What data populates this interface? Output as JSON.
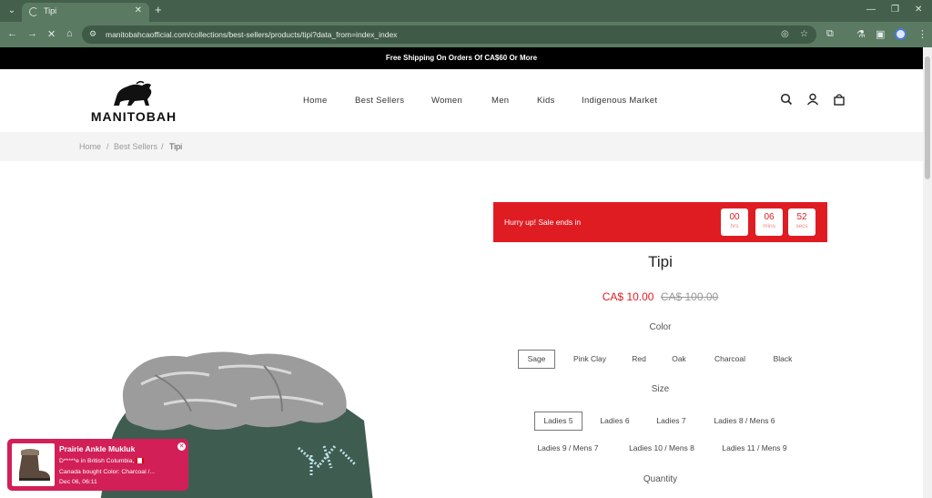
{
  "browser": {
    "tab_title": "Tipi",
    "url": "manitobahcaofficial.com/collections/best-sellers/products/tipi?data_from=index_index"
  },
  "announcement": "Free Shipping On Orders Of CA$60 Or More",
  "header": {
    "logo_text": "MANITOBAH",
    "nav": [
      "Home",
      "Best Sellers",
      "Women",
      "Men",
      "Kids",
      "Indigenous Market"
    ]
  },
  "breadcrumb": [
    "Home",
    "Best Sellers",
    "Tipi"
  ],
  "timer": {
    "label": "Hurry up!  Sale ends in",
    "hours": "00",
    "hours_unit": "hrs",
    "mins": "06",
    "mins_unit": "mins",
    "secs": "52",
    "secs_unit": "secs",
    "color": "#e01c23"
  },
  "product": {
    "title": "Tipi",
    "sale_price": "CA$ 10.00",
    "orig_price": "CA$ 100.00",
    "color_label": "Color",
    "colors": [
      "Sage",
      "Pink Clay",
      "Red",
      "Oak",
      "Charcoal",
      "Black"
    ],
    "selected_color": "Sage",
    "size_label": "Size",
    "sizes_row1": [
      "Ladies 5",
      "Ladies 6",
      "Ladies 7",
      "Ladies 8 / Mens 6"
    ],
    "sizes_row2": [
      "Ladies 9 / Mens 7",
      "Ladies 10 / Mens 8",
      "Ladies 11 / Mens 9"
    ],
    "selected_size": "Ladies 5",
    "quantity_label": "Quantity"
  },
  "popup": {
    "title": "Prairie Ankle Mukluk",
    "line1": "D*****e in British Columbia,",
    "line2": "Canada bought Color: Charcoal /...",
    "line3": "Dec 06, 06:11",
    "color": "#d21f57"
  }
}
